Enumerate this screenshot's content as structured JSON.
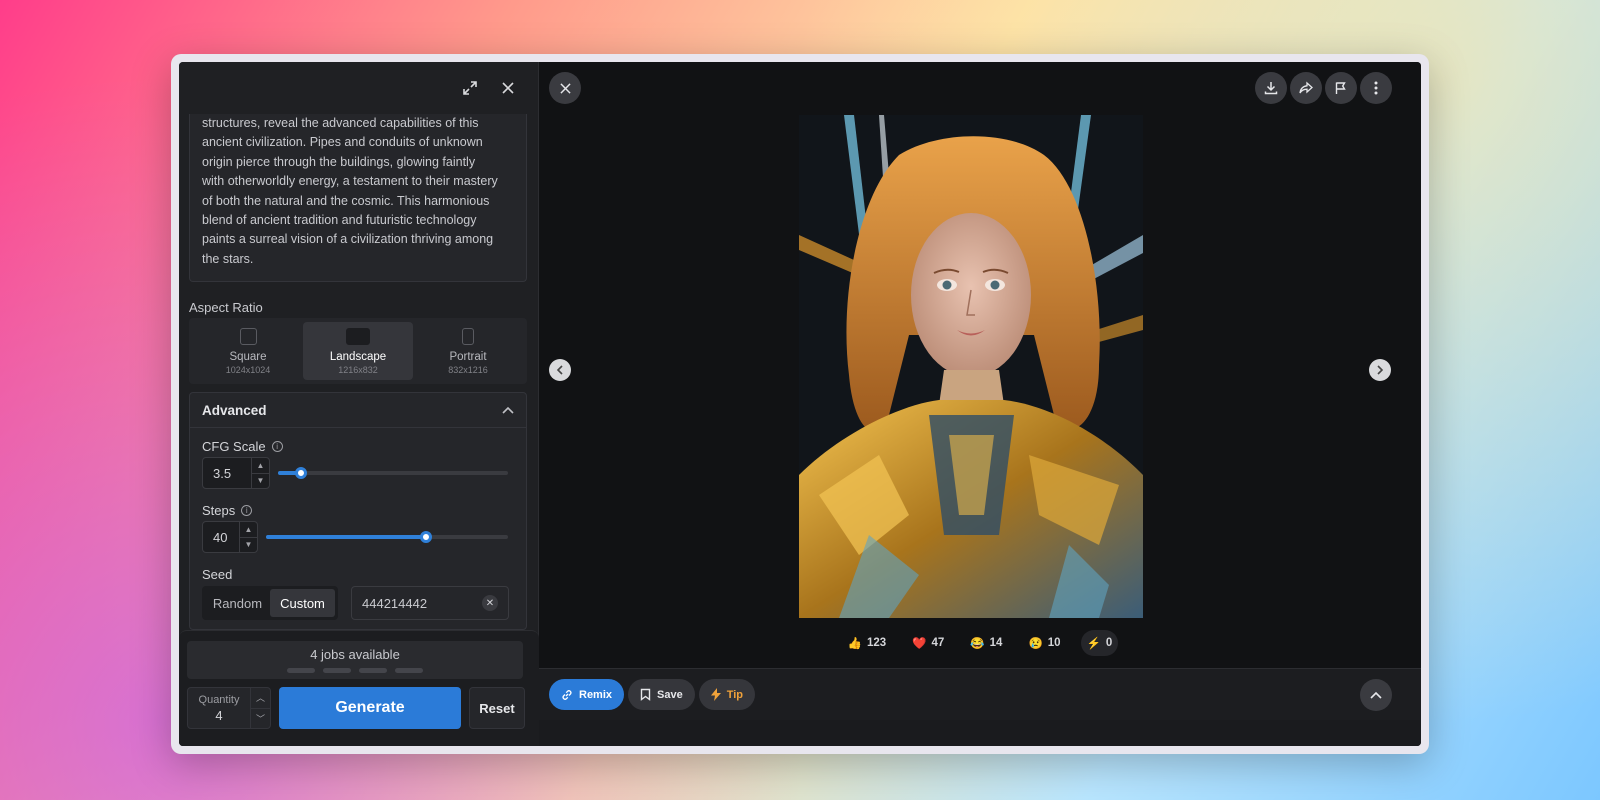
{
  "prompt": {
    "lines": [
      "structures, reveal the advanced capabilities of this",
      "ancient civilization. Pipes and conduits of unknown",
      "origin pierce through the buildings, glowing faintly",
      "with otherworldly energy, a testament to their mastery",
      "of both the natural and the cosmic. This harmonious",
      "blend of ancient tradition and futuristic technology",
      "paints a surreal vision of a civilization thriving among",
      "the stars."
    ]
  },
  "aspect_ratio": {
    "label": "Aspect Ratio",
    "options": [
      {
        "name": "Square",
        "size": "1024x1024"
      },
      {
        "name": "Landscape",
        "size": "1216x832"
      },
      {
        "name": "Portrait",
        "size": "832x1216"
      }
    ],
    "selected": "Landscape"
  },
  "advanced": {
    "title": "Advanced",
    "cfg_scale": {
      "label": "CFG Scale",
      "value": "3.5",
      "fraction": 0.1
    },
    "steps": {
      "label": "Steps",
      "value": "40",
      "fraction": 0.66
    },
    "seed": {
      "label": "Seed",
      "modes": [
        "Random",
        "Custom"
      ],
      "selected": "Custom",
      "value": "444214442"
    }
  },
  "generate": {
    "jobs_text": "4 jobs available",
    "quantity_label": "Quantity",
    "quantity_value": "4",
    "generate_label": "Generate",
    "reset_label": "Reset"
  },
  "reactions": [
    {
      "emoji": "👍",
      "count": "123"
    },
    {
      "emoji": "❤️",
      "count": "47"
    },
    {
      "emoji": "😂",
      "count": "14"
    },
    {
      "emoji": "😢",
      "count": "10"
    },
    {
      "emoji": "⚡",
      "count": "0"
    }
  ],
  "actions": {
    "remix": "Remix",
    "save": "Save",
    "tip": "Tip"
  },
  "colors": {
    "accent": "#2b7bd8",
    "tip": "#f0a23a"
  }
}
